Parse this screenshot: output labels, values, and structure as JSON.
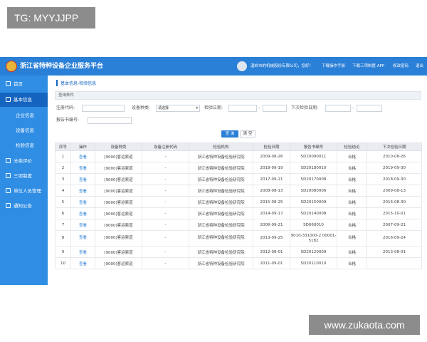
{
  "watermark_top": "TG: MYYJJPP",
  "watermark_bottom": "www.zukaota.com",
  "header": {
    "title": "浙江省特种设备企业服务平台",
    "company": "温岭市的机械股份有限公司，您好！",
    "manual": "下载操作手册",
    "app": "下载三项制度 APP",
    "change_pwd": "修改密码",
    "logout": "退出"
  },
  "sidebar": {
    "home": "首页",
    "basic": "基本信息",
    "sub": [
      "企业信息",
      "设备信息",
      "检验信息"
    ],
    "items": [
      "分类评价",
      "三项制度",
      "单位人员管理",
      "通知公告"
    ]
  },
  "breadcrumb": "基本信息-检验信息",
  "panel_title": "查询条件",
  "form": {
    "reg_code": "注册代码:",
    "device_type": "设备种类:",
    "device_type_value": "请选择",
    "check_date": "检验日期:",
    "next_date": "下次检验日期:",
    "report_no": "报告书编号:",
    "range_sep": "-",
    "query": "查 询",
    "clear": "清 空"
  },
  "table": {
    "headers": [
      "序号",
      "操作",
      "设备种类",
      "设备注册代码",
      "检验机构",
      "检验日期",
      "报告书编号",
      "检验结论",
      "下次检验日期"
    ],
    "rows": [
      [
        "1",
        "查看",
        "[9000]客运索道",
        "-",
        "浙江省特种设备检验研究院",
        "2009-08-26",
        "SD20090011",
        "合格",
        "2010-08-26"
      ],
      [
        "2",
        "查看",
        "[9000]客运索道",
        "-",
        "浙江省特种设备检验研究院",
        "2018-09-19",
        "SD20180010",
        "合格",
        "2019-09-30"
      ],
      [
        "3",
        "查看",
        "[9000]客运索道",
        "-",
        "浙江省特种设备检验研究院",
        "2017-09-21",
        "SD20170008",
        "合格",
        "2018-09-30"
      ],
      [
        "4",
        "查看",
        "[9000]客运索道",
        "-",
        "浙江省特种设备检验研究院",
        "2008-08-13",
        "SD20080006",
        "合格",
        "2009-08-13"
      ],
      [
        "5",
        "查看",
        "[9000]客运索道",
        "-",
        "浙江省特种设备检验研究院",
        "2015-08-25",
        "SD20150009",
        "合格",
        "2016-08-30"
      ],
      [
        "6",
        "查看",
        "[9000]客运索道",
        "-",
        "浙江省特种设备检验研究院",
        "2014-09-17",
        "SD20140008",
        "合格",
        "2015-10-01"
      ],
      [
        "7",
        "查看",
        "[9000]客运索道",
        "-",
        "浙江省特种设备检验研究院",
        "2006-09-21",
        "SD060010",
        "合格",
        "2007-09-21"
      ],
      [
        "8",
        "查看",
        "[9000]客运索道",
        "-",
        "浙江省特种设备检验研究院",
        "2013-09-25",
        "9010-331000-2 00001-5182",
        "合格",
        "2016-09-24"
      ],
      [
        "9",
        "查看",
        "[9000]客运索道",
        "-",
        "浙江省特种设备检验研究院",
        "2012-08-01",
        "SD20120009",
        "合格",
        "2013-08-01"
      ],
      [
        "10",
        "查看",
        "[9000]客运索道",
        "-",
        "浙江省特种设备检验研究院",
        "2011-09-01",
        "SD20110010",
        "合格",
        ""
      ]
    ]
  }
}
